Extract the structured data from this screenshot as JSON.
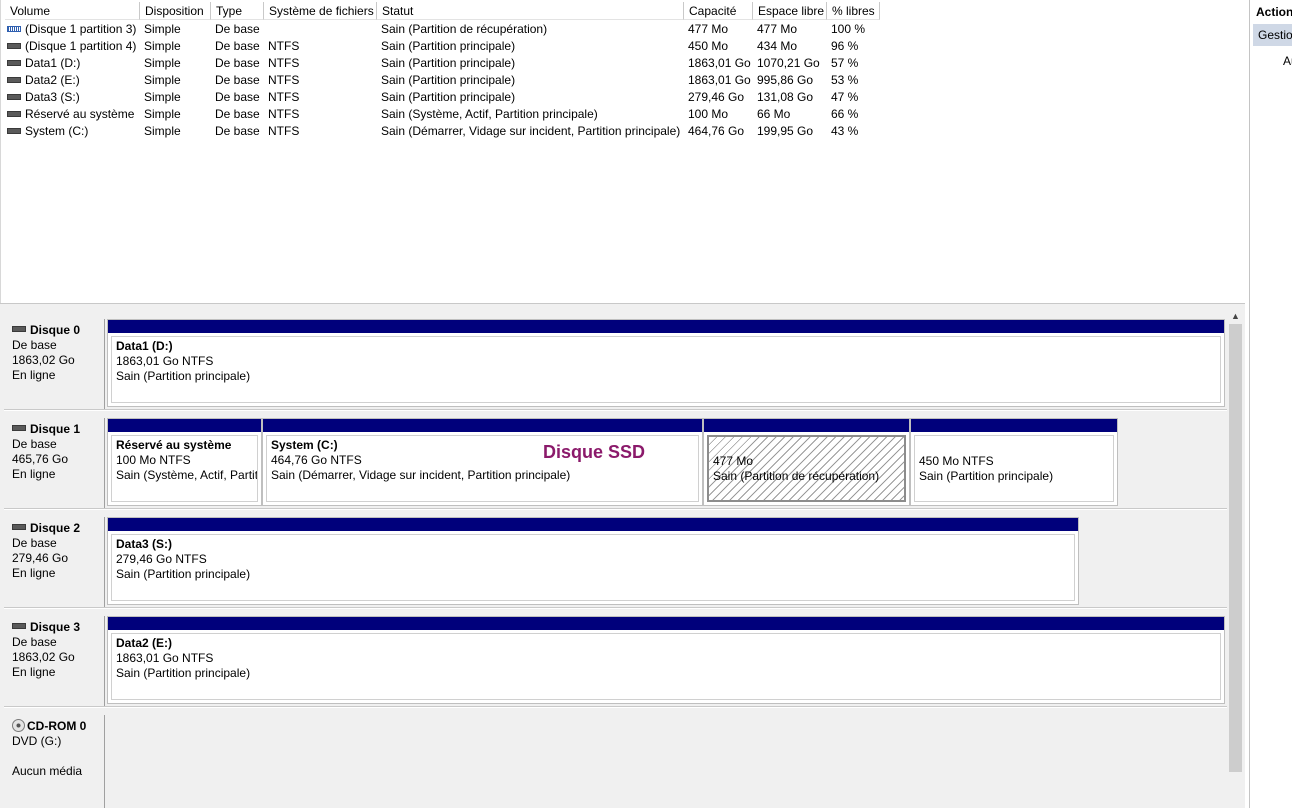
{
  "volume_list": {
    "columns": [
      "Volume",
      "Disposition",
      "Type",
      "Système de fichiers",
      "Statut",
      "Capacité",
      "Espace libre",
      "% libres"
    ],
    "rows": [
      {
        "name": "(Disque 1 partition 3)",
        "layout": "Simple",
        "type": "De base",
        "fs": "",
        "status": "Sain (Partition de récupération)",
        "capacity": "477 Mo",
        "free": "477 Mo",
        "pct": "100 %",
        "icon": "recovery-volume-icon"
      },
      {
        "name": "(Disque 1 partition 4)",
        "layout": "Simple",
        "type": "De base",
        "fs": "NTFS",
        "status": "Sain (Partition principale)",
        "capacity": "450 Mo",
        "free": "434 Mo",
        "pct": "96 %",
        "icon": "volume-icon"
      },
      {
        "name": "Data1 (D:)",
        "layout": "Simple",
        "type": "De base",
        "fs": "NTFS",
        "status": "Sain (Partition principale)",
        "capacity": "1863,01 Go",
        "free": "1070,21 Go",
        "pct": "57 %",
        "icon": "volume-icon"
      },
      {
        "name": "Data2 (E:)",
        "layout": "Simple",
        "type": "De base",
        "fs": "NTFS",
        "status": "Sain (Partition principale)",
        "capacity": "1863,01 Go",
        "free": "995,86 Go",
        "pct": "53 %",
        "icon": "volume-icon"
      },
      {
        "name": "Data3 (S:)",
        "layout": "Simple",
        "type": "De base",
        "fs": "NTFS",
        "status": "Sain (Partition principale)",
        "capacity": "279,46 Go",
        "free": "131,08 Go",
        "pct": "47 %",
        "icon": "volume-icon"
      },
      {
        "name": "Réservé au système",
        "layout": "Simple",
        "type": "De base",
        "fs": "NTFS",
        "status": "Sain (Système, Actif, Partition principale)",
        "capacity": "100 Mo",
        "free": "66 Mo",
        "pct": "66 %",
        "icon": "volume-icon"
      },
      {
        "name": "System (C:)",
        "layout": "Simple",
        "type": "De base",
        "fs": "NTFS",
        "status": "Sain (Démarrer, Vidage sur incident, Partition principale)",
        "capacity": "464,76 Go",
        "free": "199,95 Go",
        "pct": "43 %",
        "icon": "volume-icon"
      }
    ]
  },
  "disks": [
    {
      "name": "Disque 0",
      "kind": "De base",
      "size": "1863,02 Go",
      "state": "En ligne",
      "partitions": [
        {
          "title": "Data1  (D:)",
          "size": "1863,01 Go NTFS",
          "status": "Sain (Partition principale)"
        }
      ]
    },
    {
      "name": "Disque 1",
      "kind": "De base",
      "size": "465,76 Go",
      "state": "En ligne",
      "partitions": [
        {
          "title": "Réservé au système",
          "size": "100 Mo NTFS",
          "status": "Sain (Système, Actif, Partit"
        },
        {
          "title": "System  (C:)",
          "size": "464,76 Go NTFS",
          "status": "Sain (Démarrer, Vidage sur incident, Partition principale)"
        },
        {
          "title": "",
          "size": "477 Mo",
          "status": "Sain (Partition de récupération)"
        },
        {
          "title": "",
          "size": "450 Mo NTFS",
          "status": "Sain (Partition principale)"
        }
      ],
      "annotation": "Disque SSD"
    },
    {
      "name": "Disque 2",
      "kind": "De base",
      "size": "279,46 Go",
      "state": "En ligne",
      "partitions": [
        {
          "title": "Data3  (S:)",
          "size": "279,46 Go NTFS",
          "status": "Sain (Partition principale)"
        }
      ]
    },
    {
      "name": "Disque 3",
      "kind": "De base",
      "size": "1863,02 Go",
      "state": "En ligne",
      "partitions": [
        {
          "title": "Data2  (E:)",
          "size": "1863,01 Go NTFS",
          "status": "Sain (Partition principale)"
        }
      ]
    }
  ],
  "cdrom": {
    "name": "CD-ROM 0",
    "drive": "DVD (G:)",
    "media": "Aucun média"
  },
  "actions": {
    "title": "Action",
    "section": "Gestio",
    "item": "Au"
  },
  "colors": {
    "partition_bar": "#00007b",
    "annotation": "#8b1a6b"
  }
}
